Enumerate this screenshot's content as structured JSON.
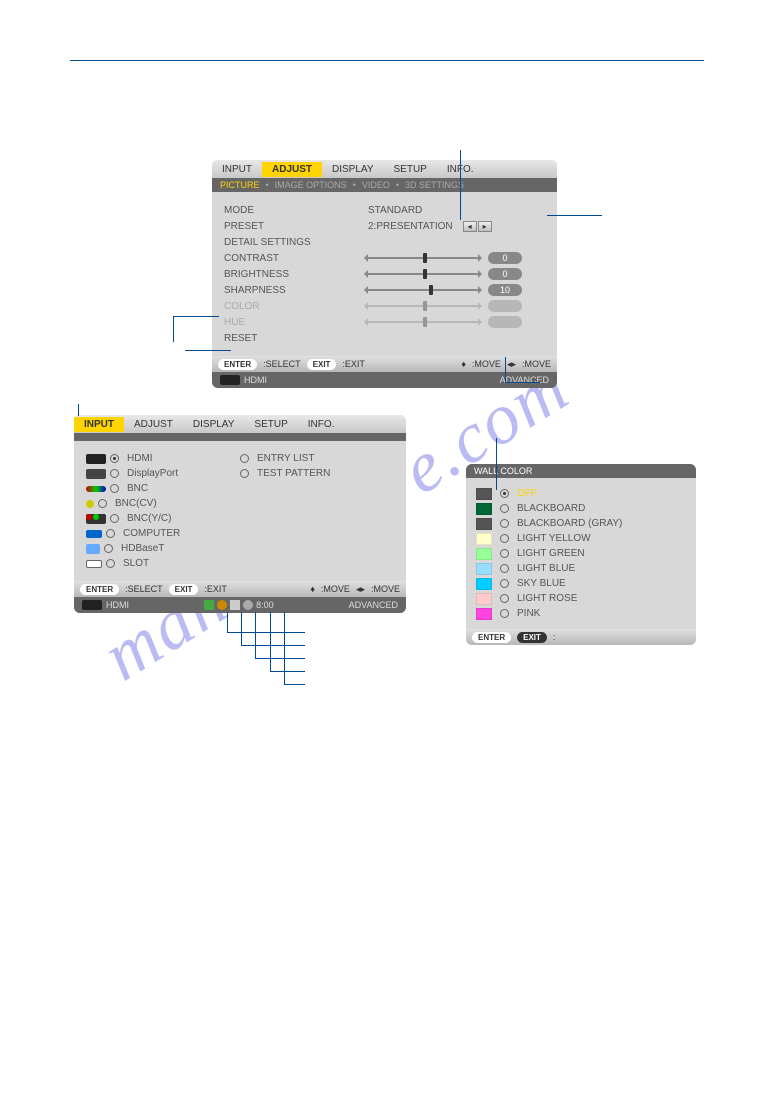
{
  "panel1": {
    "tabs": [
      "INPUT",
      "ADJUST",
      "DISPLAY",
      "SETUP",
      "INFO."
    ],
    "active_tab": "ADJUST",
    "subtabs": [
      "PICTURE",
      "IMAGE OPTIONS",
      "VIDEO",
      "3D SETTINGS"
    ],
    "active_subtab": "PICTURE",
    "rows": {
      "mode": {
        "label": "MODE",
        "value": "STANDARD"
      },
      "preset": {
        "label": "PRESET",
        "value": "2:PRESENTATION"
      },
      "detail": {
        "label": "DETAIL SETTINGS"
      },
      "contrast": {
        "label": "CONTRAST",
        "num": "0",
        "pos": 50
      },
      "brightness": {
        "label": "BRIGHTNESS",
        "num": "0",
        "pos": 50
      },
      "sharpness": {
        "label": "SHARPNESS",
        "num": "10",
        "pos": 55
      },
      "color": {
        "label": "COLOR",
        "pos": 50
      },
      "hue": {
        "label": "HUE",
        "pos": 50
      },
      "reset": {
        "label": "RESET"
      }
    },
    "help": {
      "enter": "ENTER",
      "select": ":SELECT",
      "exit": "EXIT",
      "exit_lbl": ":EXIT",
      "move1": ":MOVE",
      "move2": ":MOVE"
    },
    "footer": {
      "src": "HDMI",
      "mode": "ADVANCED"
    }
  },
  "panel2": {
    "tabs": [
      "INPUT",
      "ADJUST",
      "DISPLAY",
      "SETUP",
      "INFO."
    ],
    "active_tab": "INPUT",
    "items_left": [
      {
        "icon": "hdmi",
        "sel": true,
        "label": "HDMI"
      },
      {
        "icon": "dp",
        "sel": false,
        "label": "DisplayPort"
      },
      {
        "icon": "bnc",
        "sel": false,
        "label": "BNC"
      },
      {
        "icon": "bnccv",
        "sel": false,
        "label": "BNC(CV)"
      },
      {
        "icon": "bncyc",
        "sel": false,
        "label": "BNC(Y/C)"
      },
      {
        "icon": "comp",
        "sel": false,
        "label": "COMPUTER"
      },
      {
        "icon": "hdbt",
        "sel": false,
        "label": "HDBaseT"
      },
      {
        "icon": "slot",
        "sel": false,
        "label": "SLOT"
      }
    ],
    "items_right": [
      {
        "sel": false,
        "label": "ENTRY LIST"
      },
      {
        "sel": false,
        "label": "TEST PATTERN"
      }
    ],
    "help": {
      "enter": "ENTER",
      "select": ":SELECT",
      "exit": "EXIT",
      "exit_lbl": ":EXIT",
      "move1": ":MOVE",
      "move2": ":MOVE"
    },
    "footer": {
      "src": "HDMI",
      "time": "8:00",
      "mode": "ADVANCED"
    }
  },
  "panel3": {
    "title": "WALL COLOR",
    "items": [
      {
        "color": "#555",
        "label": "OFF",
        "sel": true,
        "hl": true
      },
      {
        "color": "#063",
        "label": "BLACKBOARD"
      },
      {
        "color": "#555",
        "label": "BLACKBOARD (GRAY)"
      },
      {
        "color": "#ffc",
        "label": "LIGHT YELLOW"
      },
      {
        "color": "#9f9",
        "label": "LIGHT GREEN"
      },
      {
        "color": "#9df",
        "label": "LIGHT BLUE"
      },
      {
        "color": "#0cf",
        "label": "SKY BLUE"
      },
      {
        "color": "#fcc",
        "label": "LIGHT ROSE"
      },
      {
        "color": "#f4d",
        "label": "PINK"
      }
    ],
    "help": {
      "enter": "ENTER",
      "exit": "EXIT",
      "move": ":"
    }
  },
  "watermark": "manualshive.com"
}
